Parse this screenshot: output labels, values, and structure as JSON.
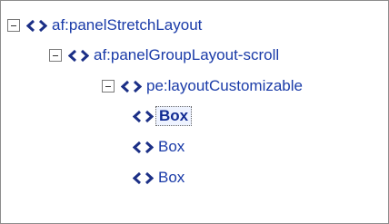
{
  "tree": {
    "nodes": [
      {
        "label": "af:panelStretchLayout",
        "expanded": true,
        "selected": false,
        "icon": "xml-tag-icon"
      },
      {
        "label": "af:panelGroupLayout-scroll",
        "expanded": true,
        "selected": false,
        "icon": "xml-tag-icon"
      },
      {
        "label": "pe:layoutCustomizable",
        "expanded": true,
        "selected": false,
        "icon": "xml-tag-icon"
      },
      {
        "label": "Box",
        "expanded": null,
        "selected": true,
        "icon": "xml-tag-icon"
      },
      {
        "label": "Box",
        "expanded": null,
        "selected": false,
        "icon": "xml-tag-icon"
      },
      {
        "label": "Box",
        "expanded": null,
        "selected": false,
        "icon": "xml-tag-icon"
      }
    ]
  },
  "colors": {
    "link_text": "#1a3ba8",
    "icon": "#1b2f86",
    "border": "#8c8c8c"
  }
}
